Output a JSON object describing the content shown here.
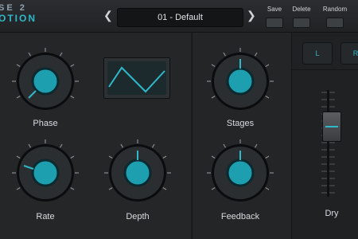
{
  "header": {
    "logo_line1": "SE 2",
    "logo_line2": "OTION",
    "prev_icon": "chevron-left-icon",
    "next_icon": "chevron-right-icon",
    "preset_name": "01 - Default",
    "buttons": [
      {
        "label": "Save"
      },
      {
        "label": "Delete"
      },
      {
        "label": "Random"
      }
    ]
  },
  "knobs": {
    "phase": {
      "label": "Phase"
    },
    "rate": {
      "label": "Rate"
    },
    "depth": {
      "label": "Depth"
    },
    "stages": {
      "label": "Stages"
    },
    "feedback": {
      "label": "Feedback"
    }
  },
  "lfo": {
    "waveform": "triangle"
  },
  "channels": {
    "left": "L",
    "right": "R"
  },
  "dry": {
    "label": "Dry"
  },
  "colors": {
    "accent": "#2fb8c9",
    "background": "#1d1f21"
  }
}
